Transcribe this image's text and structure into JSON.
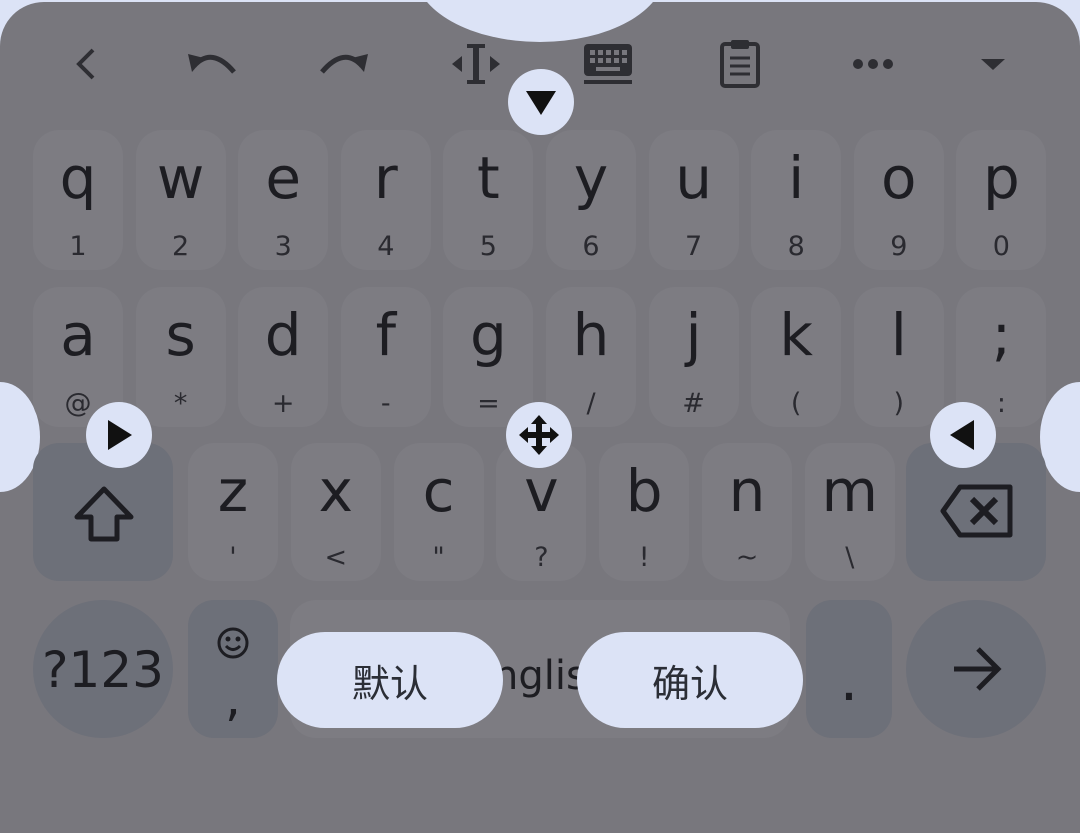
{
  "toolbar": {
    "icons": [
      "back-icon",
      "undo-icon",
      "redo-icon",
      "text-cursor-icon",
      "keyboard-icon",
      "clipboard-icon",
      "more-icon",
      "collapse-icon"
    ]
  },
  "rows": {
    "row1": [
      {
        "key": "q",
        "sub": "1"
      },
      {
        "key": "w",
        "sub": "2"
      },
      {
        "key": "e",
        "sub": "3"
      },
      {
        "key": "r",
        "sub": "4"
      },
      {
        "key": "t",
        "sub": "5"
      },
      {
        "key": "y",
        "sub": "6"
      },
      {
        "key": "u",
        "sub": "7"
      },
      {
        "key": "i",
        "sub": "8"
      },
      {
        "key": "o",
        "sub": "9"
      },
      {
        "key": "p",
        "sub": "0"
      }
    ],
    "row2": [
      {
        "key": "a",
        "sub": "@"
      },
      {
        "key": "s",
        "sub": "*"
      },
      {
        "key": "d",
        "sub": "+"
      },
      {
        "key": "f",
        "sub": "-"
      },
      {
        "key": "g",
        "sub": "="
      },
      {
        "key": "h",
        "sub": "/"
      },
      {
        "key": "j",
        "sub": "#"
      },
      {
        "key": "k",
        "sub": "("
      },
      {
        "key": "l",
        "sub": ")"
      },
      {
        "key": ";",
        "sub": ":"
      }
    ],
    "row3": [
      {
        "key": "z",
        "sub": "'"
      },
      {
        "key": "x",
        "sub": "<"
      },
      {
        "key": "c",
        "sub": "\""
      },
      {
        "key": "v",
        "sub": "?"
      },
      {
        "key": "b",
        "sub": "!"
      },
      {
        "key": "n",
        "sub": "~"
      },
      {
        "key": "m",
        "sub": "\\"
      }
    ]
  },
  "bottom": {
    "symbols_label": "?123",
    "comma_label": ",",
    "space_label": "English",
    "period_label": ".",
    "enter_icon": "arrow-right-icon"
  },
  "buttons": {
    "default_label": "默认",
    "confirm_label": "确认"
  },
  "colors": {
    "keyboard_bg": "#78777D",
    "key_bg": "#7D7C82",
    "control_bg": "#DCE3F6"
  }
}
